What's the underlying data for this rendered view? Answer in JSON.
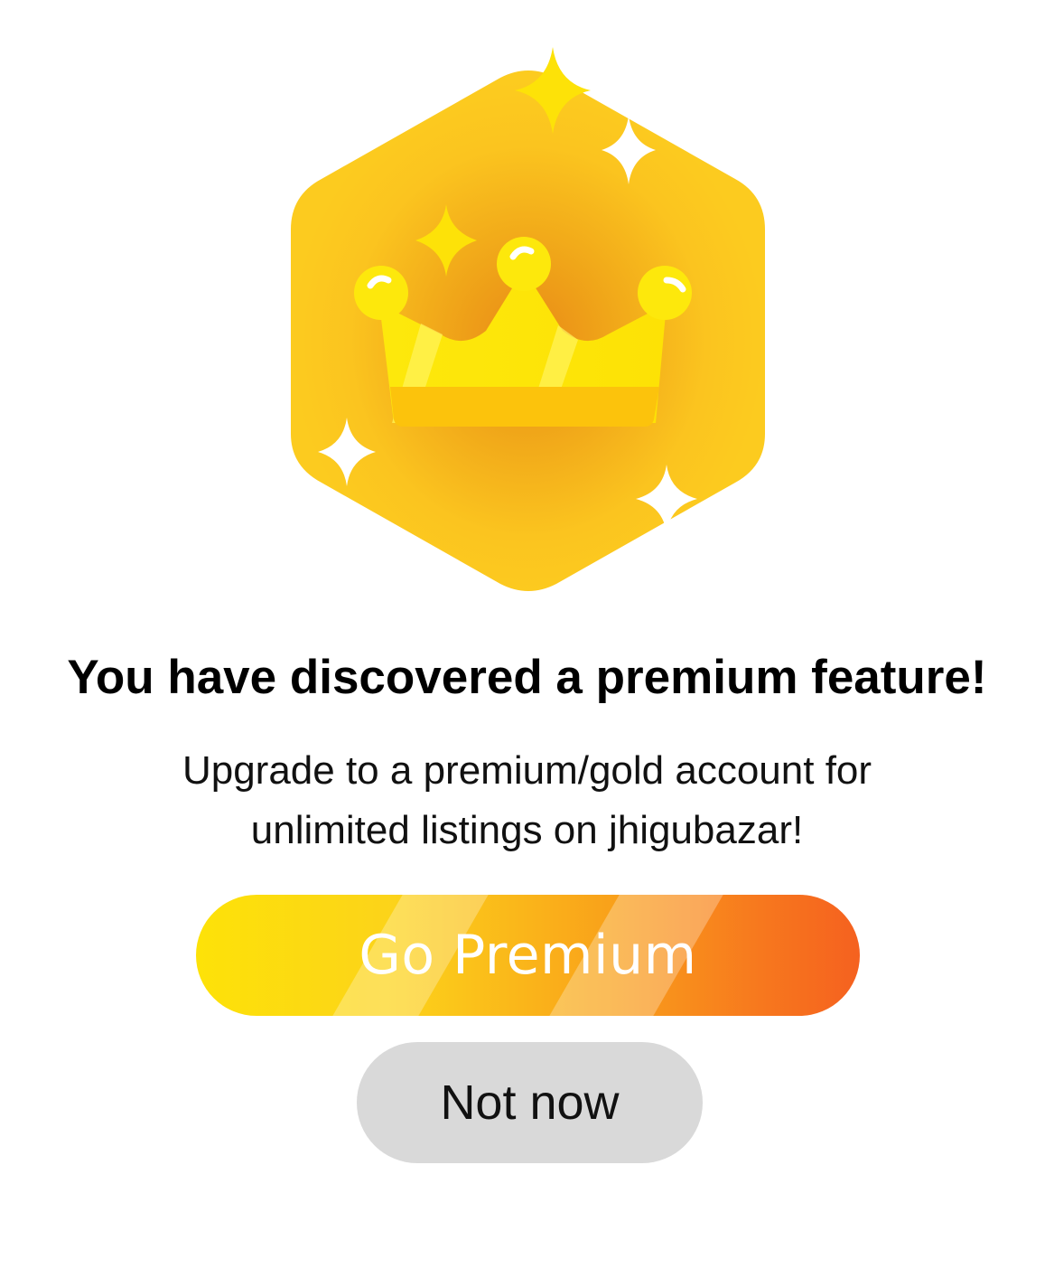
{
  "dialog": {
    "badge_icon": "crown-hexagon-badge-icon",
    "headline": "You have discovered a premium feature!",
    "message_line1": "Upgrade to a premium/gold account for",
    "message_line2": "unlimited listings on jhigubazar!",
    "primary_button_label": "Go Premium",
    "secondary_button_label": "Not now"
  },
  "colors": {
    "badge_gold": "#fccb1f",
    "badge_inner_glow": "#f0a619",
    "crown_yellow": "#fde208",
    "crown_band": "#fcc30c",
    "premium_gradient_start": "#fde208",
    "premium_gradient_end": "#f5611f",
    "secondary_button_bg": "#d9d9d9",
    "text_primary": "#000000"
  }
}
